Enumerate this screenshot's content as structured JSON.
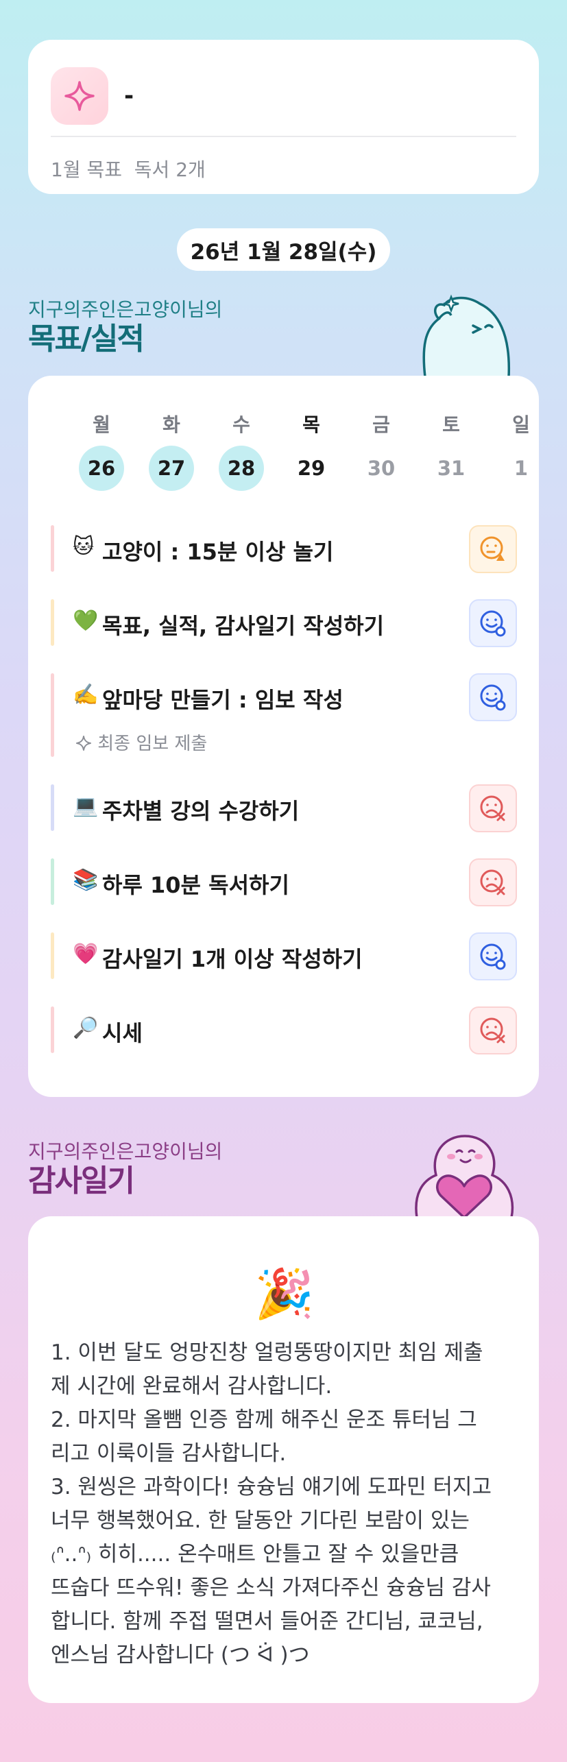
{
  "goal": {
    "title": "-",
    "subtitle": "1월 목표  독서 2개"
  },
  "date": "26년 1월 28일(수)",
  "goals_section": {
    "user_line": "지구의주인은고양이님의",
    "title": "목표/실적"
  },
  "week": [
    {
      "name": "월",
      "num": "26",
      "state": "done"
    },
    {
      "name": "화",
      "num": "27",
      "state": "done"
    },
    {
      "name": "수",
      "num": "28",
      "state": "done"
    },
    {
      "name": "목",
      "num": "29",
      "state": "today"
    },
    {
      "name": "금",
      "num": "30",
      "state": "future"
    },
    {
      "name": "토",
      "num": "31",
      "state": "future"
    },
    {
      "name": "일",
      "num": "1",
      "state": "future"
    }
  ],
  "tasks": [
    {
      "emoji": "🐱",
      "label": "고양이 : 15분 이상 놀기",
      "status": "warn",
      "bar": "#fbd3d6"
    },
    {
      "emoji": "💚",
      "label": "목표, 실적, 감사일기 작성하기",
      "status": "good",
      "bar": "#fde9c2"
    },
    {
      "emoji": "✍️",
      "label": "앞마당 만들기 : 임보 작성",
      "status": "good",
      "bar": "#fbd3d6",
      "sub": "최종 임보 제출"
    },
    {
      "emoji": "💻",
      "label": "주차별 강의 수강하기",
      "status": "bad",
      "bar": "#d7dcf7"
    },
    {
      "emoji": "📚",
      "label": "하루 10분 독서하기",
      "status": "bad",
      "bar": "#c7eedd"
    },
    {
      "emoji": "💗",
      "label": "감사일기 1개 이상 작성하기",
      "status": "good",
      "bar": "#fde9c2"
    },
    {
      "emoji": "🔎",
      "label": "시세",
      "status": "bad",
      "bar": "#fbd3d6"
    }
  ],
  "gratitude_section": {
    "user_line": "지구의주인은고양이님의",
    "title": "감사일기"
  },
  "gratitude": {
    "emoji": "🎉",
    "text": "1. 이번 달도 엉망진창 얼렁뚱땅이지만 최임 제출\n제 시간에 완료해서 감사합니다.\n2. 마지막 올뺌 인증 함께 해주신 운조 튜터님 그\n리고 이룩이들 감사합니다.\n3. 원씽은 과학이다! 슝슝님 얘기에 도파민 터지고\n너무 행복했어요. 한 달동안 기다린 보람이 있는\n₍ᐢ..ᐢ₎ 히히..... 온수매트 안틀고 잘 수 있을만큼\n뜨숩다 뜨수워! 좋은 소식 가져다주신 슝슝님 감사\n합니다. 함께 주접 떨면서 들어준 간디님, 쿄코님,\n엔스님 감사합니다 (つ ᐛ )つ"
  },
  "colors": {
    "teal": "#136d78",
    "purple": "#7a2e7c",
    "good": "#2f5fe0",
    "bad": "#e05a5a",
    "warn": "#f0932b"
  }
}
